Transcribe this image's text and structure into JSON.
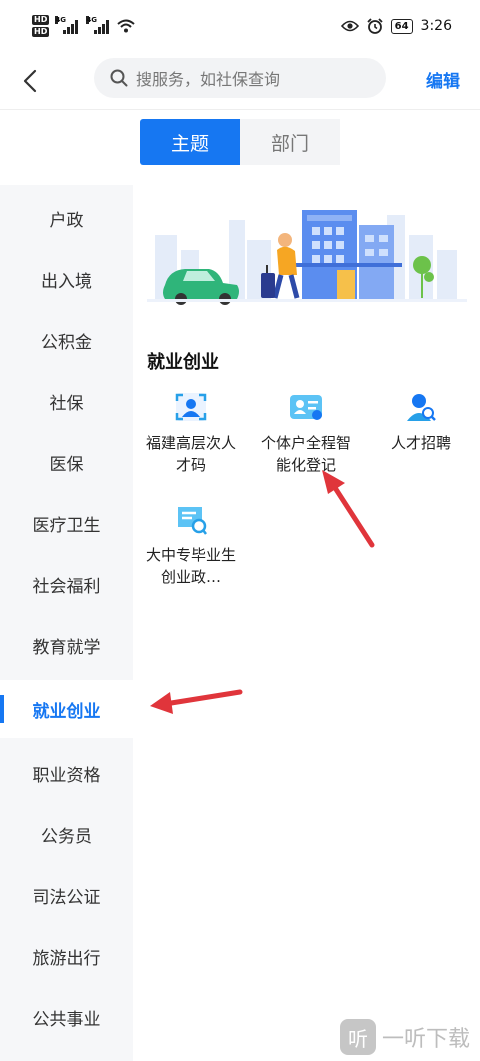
{
  "status_bar": {
    "hd_labels": [
      "HD",
      "HD"
    ],
    "net_labels": [
      "4G",
      "4G"
    ],
    "battery": "64",
    "time": "3:26"
  },
  "nav": {
    "search_placeholder": "搜服务，如社保查询",
    "edit_label": "编辑"
  },
  "tabs": [
    {
      "label": "主题",
      "active": true
    },
    {
      "label": "部门",
      "active": false
    }
  ],
  "sidebar": {
    "items": [
      {
        "label": "户政"
      },
      {
        "label": "出入境"
      },
      {
        "label": "公积金"
      },
      {
        "label": "社保"
      },
      {
        "label": "医保"
      },
      {
        "label": "医疗卫生"
      },
      {
        "label": "社会福利"
      },
      {
        "label": "教育就学"
      },
      {
        "label": "就业创业",
        "active": true
      },
      {
        "label": "职业资格"
      },
      {
        "label": "公务员"
      },
      {
        "label": "司法公证"
      },
      {
        "label": "旅游出行"
      },
      {
        "label": "公共事业"
      }
    ]
  },
  "section": {
    "title": "就业创业",
    "services": [
      {
        "label": "福建高层次人才码",
        "icon": "face-scan-icon"
      },
      {
        "label": "个体户全程智能化登记",
        "icon": "id-card-icon"
      },
      {
        "label": "人才招聘",
        "icon": "talent-search-icon"
      },
      {
        "label": "大中专毕业生创业政…",
        "icon": "certificate-icon"
      }
    ]
  },
  "watermark": {
    "logo": "听",
    "text": "一听下载"
  },
  "colors": {
    "accent": "#1677f2",
    "annotation_arrow": "#e0353b",
    "sidebar_bg": "#f6f7f9"
  }
}
